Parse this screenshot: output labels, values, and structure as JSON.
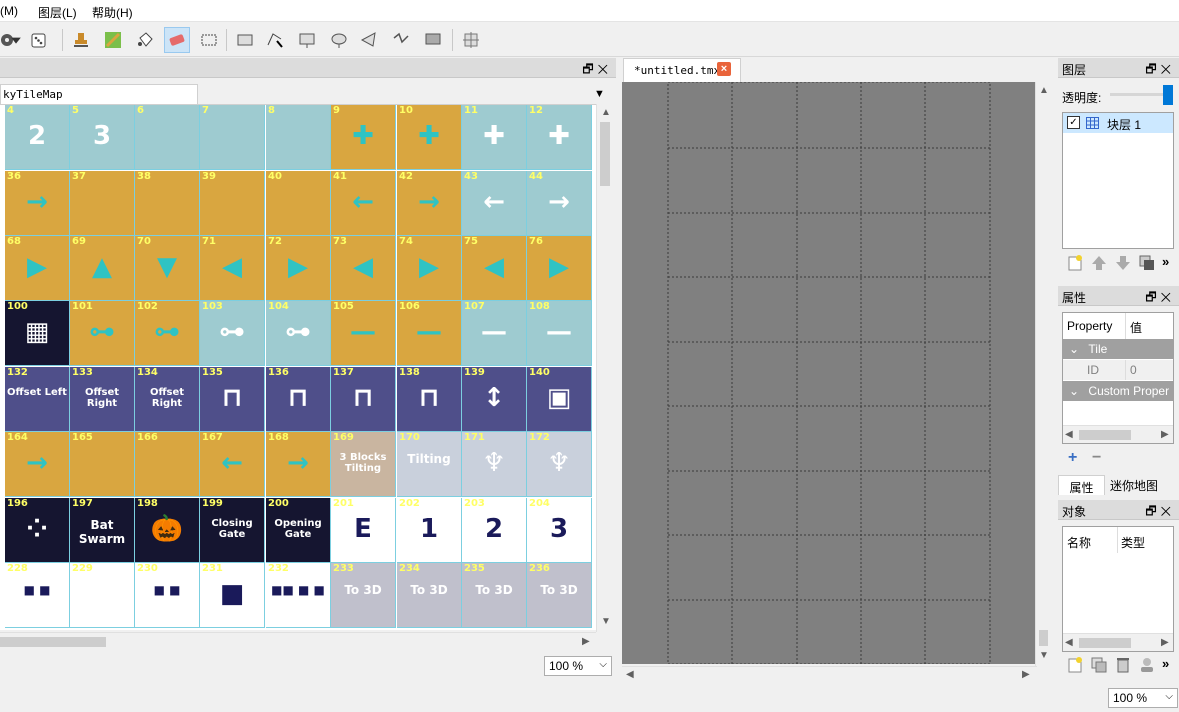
{
  "menu": {
    "items": [
      "(M)",
      "图层(L)",
      "帮助(H)"
    ]
  },
  "tileset": {
    "tab_label": "kyTileMap",
    "zoom": "100 %",
    "rows": [
      [
        {
          "n": "4",
          "bg": "#9ecbd0",
          "lbl": "2"
        },
        {
          "n": "5",
          "bg": "#9ecbd0",
          "lbl": "3"
        },
        {
          "n": "6",
          "bg": "#9ecbd0",
          "lbl": ""
        },
        {
          "n": "7",
          "bg": "#9ecbd0",
          "lbl": ""
        },
        {
          "n": "8",
          "bg": "#9ecbd0",
          "lbl": ""
        },
        {
          "n": "9",
          "bg": "#d9a640",
          "lbl": "✚"
        },
        {
          "n": "10",
          "bg": "#d9a640",
          "lbl": "✚"
        },
        {
          "n": "11",
          "bg": "#9ecbd0",
          "lbl": "✚"
        },
        {
          "n": "12",
          "bg": "#9ecbd0",
          "lbl": "✚"
        }
      ],
      [
        {
          "n": "36",
          "bg": "#d9a640",
          "lbl": "→"
        },
        {
          "n": "37",
          "bg": "#d9a640",
          "lbl": ""
        },
        {
          "n": "38",
          "bg": "#d9a640",
          "lbl": ""
        },
        {
          "n": "39",
          "bg": "#d9a640",
          "lbl": ""
        },
        {
          "n": "40",
          "bg": "#d9a640",
          "lbl": ""
        },
        {
          "n": "41",
          "bg": "#d9a640",
          "lbl": "←"
        },
        {
          "n": "42",
          "bg": "#d9a640",
          "lbl": "→"
        },
        {
          "n": "43",
          "bg": "#9ecbd0",
          "lbl": "←"
        },
        {
          "n": "44",
          "bg": "#9ecbd0",
          "lbl": "→"
        }
      ],
      [
        {
          "n": "68",
          "bg": "#d9a640",
          "lbl": "▶"
        },
        {
          "n": "69",
          "bg": "#d9a640",
          "lbl": "▲"
        },
        {
          "n": "70",
          "bg": "#d9a640",
          "lbl": "▼"
        },
        {
          "n": "71",
          "bg": "#d9a640",
          "lbl": "◀"
        },
        {
          "n": "72",
          "bg": "#d9a640",
          "lbl": "▶"
        },
        {
          "n": "73",
          "bg": "#d9a640",
          "lbl": "◀"
        },
        {
          "n": "74",
          "bg": "#d9a640",
          "lbl": "▶"
        },
        {
          "n": "75",
          "bg": "#d9a640",
          "lbl": "◀"
        },
        {
          "n": "76",
          "bg": "#d9a640",
          "lbl": "▶"
        }
      ],
      [
        {
          "n": "100",
          "bg": "#151530",
          "lbl": "▦"
        },
        {
          "n": "101",
          "bg": "#d9a640",
          "lbl": "⊶"
        },
        {
          "n": "102",
          "bg": "#d9a640",
          "lbl": "⊶"
        },
        {
          "n": "103",
          "bg": "#9ecbd0",
          "lbl": "⊶"
        },
        {
          "n": "104",
          "bg": "#9ecbd0",
          "lbl": "⊶"
        },
        {
          "n": "105",
          "bg": "#d9a640",
          "lbl": "—"
        },
        {
          "n": "106",
          "bg": "#d9a640",
          "lbl": "—"
        },
        {
          "n": "107",
          "bg": "#9ecbd0",
          "lbl": "—"
        },
        {
          "n": "108",
          "bg": "#9ecbd0",
          "lbl": "—"
        }
      ],
      [
        {
          "n": "132",
          "bg": "#4f4f8a",
          "lbl": "Offset Left"
        },
        {
          "n": "133",
          "bg": "#4f4f8a",
          "lbl": "Offset Right"
        },
        {
          "n": "134",
          "bg": "#4f4f8a",
          "lbl": "Offset Right"
        },
        {
          "n": "135",
          "bg": "#4f4f8a",
          "lbl": "⊓"
        },
        {
          "n": "136",
          "bg": "#4f4f8a",
          "lbl": "⊓"
        },
        {
          "n": "137",
          "bg": "#4f4f8a",
          "lbl": "⊓"
        },
        {
          "n": "138",
          "bg": "#4f4f8a",
          "lbl": "⊓"
        },
        {
          "n": "139",
          "bg": "#4f4f8a",
          "lbl": "↕"
        },
        {
          "n": "140",
          "bg": "#4f4f8a",
          "lbl": "▣"
        }
      ],
      [
        {
          "n": "164",
          "bg": "#d9a640",
          "lbl": "→"
        },
        {
          "n": "165",
          "bg": "#d9a640",
          "lbl": ""
        },
        {
          "n": "166",
          "bg": "#d9a640",
          "lbl": ""
        },
        {
          "n": "167",
          "bg": "#d9a640",
          "lbl": "←"
        },
        {
          "n": "168",
          "bg": "#d9a640",
          "lbl": "→"
        },
        {
          "n": "169",
          "bg": "#c9b5a0",
          "lbl": "3 Blocks Tilting"
        },
        {
          "n": "170",
          "bg": "#c9d0dc",
          "lbl": "Tilting"
        },
        {
          "n": "171",
          "bg": "#c9d0dc",
          "lbl": "♆"
        },
        {
          "n": "172",
          "bg": "#c9d0dc",
          "lbl": "♆"
        }
      ],
      [
        {
          "n": "196",
          "bg": "#151530",
          "lbl": "⁘"
        },
        {
          "n": "197",
          "bg": "#151530",
          "lbl": "Bat Swarm"
        },
        {
          "n": "198",
          "bg": "#151530",
          "lbl": "🎃"
        },
        {
          "n": "199",
          "bg": "#151530",
          "lbl": "Closing Gate"
        },
        {
          "n": "200",
          "bg": "#151530",
          "lbl": "Opening Gate"
        },
        {
          "n": "201",
          "bg": "#ffffff",
          "lbl": "E"
        },
        {
          "n": "202",
          "bg": "#ffffff",
          "lbl": "1"
        },
        {
          "n": "203",
          "bg": "#ffffff",
          "lbl": "2"
        },
        {
          "n": "204",
          "bg": "#ffffff",
          "lbl": "3"
        }
      ],
      [
        {
          "n": "228",
          "bg": "#ffffff",
          "lbl": "■ ■"
        },
        {
          "n": "229",
          "bg": "#ffffff",
          "lbl": ""
        },
        {
          "n": "230",
          "bg": "#ffffff",
          "lbl": "■ ■"
        },
        {
          "n": "231",
          "bg": "#ffffff",
          "lbl": "■"
        },
        {
          "n": "232",
          "bg": "#ffffff",
          "lbl": "■■ ■ ■"
        },
        {
          "n": "233",
          "bg": "#c0c0cc",
          "lbl": "To 3D"
        },
        {
          "n": "234",
          "bg": "#c0c0cc",
          "lbl": "To 3D"
        },
        {
          "n": "235",
          "bg": "#c0c0cc",
          "lbl": "To 3D"
        },
        {
          "n": "236",
          "bg": "#c0c0cc",
          "lbl": "To 3D"
        }
      ]
    ]
  },
  "map": {
    "tab_label": "*untitled.tmx",
    "close_label": "×"
  },
  "layers": {
    "title": "图层",
    "opacity_label": "透明度:",
    "items": [
      {
        "name": "块层 1",
        "checked": true
      }
    ]
  },
  "properties": {
    "title": "属性",
    "col_property": "Property",
    "col_value": "值",
    "group_tile": "Tile",
    "row_id_key": "ID",
    "row_id_val": "0",
    "group_custom": "Custom Proper",
    "tab_props": "属性",
    "tab_minimap": "迷你地图"
  },
  "objects": {
    "title": "对象",
    "col_name": "名称",
    "col_type": "类型"
  },
  "zoom_bottom": "100 %"
}
